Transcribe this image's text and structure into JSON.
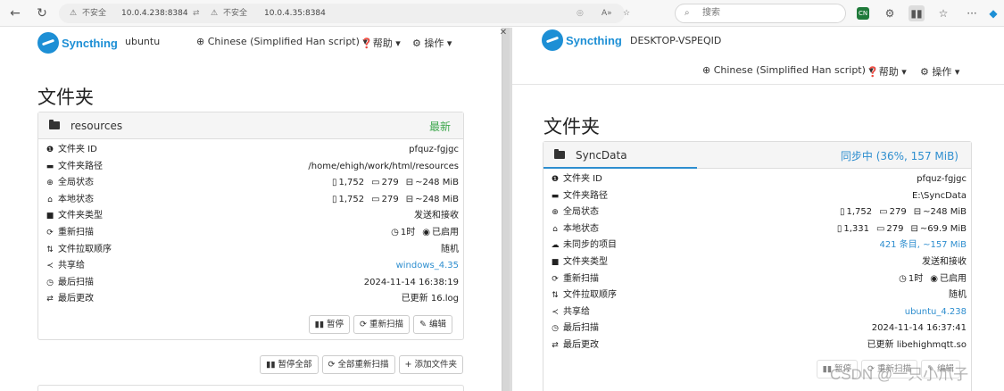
{
  "browser": {
    "url1_warn": "不安全",
    "url1": "10.0.4.238:8384",
    "url2_warn": "不安全",
    "url2": "10.0.4.35:8384",
    "search_placeholder": "搜索",
    "ext_badge": "CN"
  },
  "left": {
    "logo": "Syncthing",
    "device": "ubuntu",
    "language": "Chinese (Simplified Han script)",
    "help": "帮助",
    "actions": "操作",
    "heading": "文件夹",
    "folder": {
      "name": "resources",
      "status": "最新",
      "rows": [
        {
          "icon": "info-icon",
          "label": "文件夹 ID",
          "value": "pfquz-fgjgc"
        },
        {
          "icon": "folder-open-icon",
          "label": "文件夹路径",
          "value": "/home/ehigh/work/html/resources"
        },
        {
          "icon": "globe-icon",
          "label": "全局状态",
          "files": "1,752",
          "dirs": "279",
          "size": "~248 MiB"
        },
        {
          "icon": "home-icon",
          "label": "本地状态",
          "files": "1,752",
          "dirs": "279",
          "size": "~248 MiB"
        },
        {
          "icon": "folder-icon",
          "label": "文件夹类型",
          "value": "发送和接收"
        },
        {
          "icon": "refresh-icon",
          "label": "重新扫描",
          "interval": "1时",
          "watch": "已启用"
        },
        {
          "icon": "sort-icon",
          "label": "文件拉取顺序",
          "value": "随机"
        },
        {
          "icon": "share-icon",
          "label": "共享给",
          "value": "windows_4.35"
        },
        {
          "icon": "clock-icon",
          "label": "最后扫描",
          "value": "2024-11-14 16:38:19"
        },
        {
          "icon": "exchange-icon",
          "label": "最后更改",
          "value": "已更新 16.log"
        }
      ],
      "buttons": {
        "pause": "暂停",
        "rescan": "重新扫描",
        "edit": "编辑"
      }
    },
    "global_buttons": {
      "pause_all": "暂停全部",
      "rescan_all": "全部重新扫描",
      "add_folder": "添加文件夹"
    }
  },
  "right": {
    "logo": "Syncthing",
    "device": "DESKTOP-VSPEQID",
    "language": "Chinese (Simplified Han script)",
    "help": "帮助",
    "actions": "操作",
    "heading": "文件夹",
    "folder": {
      "name": "SyncData",
      "status": "同步中 (36%, 157 MiB)",
      "progress": 0.36,
      "rows": [
        {
          "icon": "info-icon",
          "label": "文件夹 ID",
          "value": "pfquz-fgjgc"
        },
        {
          "icon": "folder-open-icon",
          "label": "文件夹路径",
          "value": "E:\\SyncData"
        },
        {
          "icon": "globe-icon",
          "label": "全局状态",
          "files": "1,752",
          "dirs": "279",
          "size": "~248 MiB"
        },
        {
          "icon": "home-icon",
          "label": "本地状态",
          "files": "1,331",
          "dirs": "279",
          "size": "~69.9 MiB"
        },
        {
          "icon": "cloud-download-icon",
          "label": "未同步的项目",
          "value": "421 条目, ~157 MiB"
        },
        {
          "icon": "folder-icon",
          "label": "文件夹类型",
          "value": "发送和接收"
        },
        {
          "icon": "refresh-icon",
          "label": "重新扫描",
          "interval": "1时",
          "watch": "已启用"
        },
        {
          "icon": "sort-icon",
          "label": "文件拉取顺序",
          "value": "随机"
        },
        {
          "icon": "share-icon",
          "label": "共享给",
          "value": "ubuntu_4.238"
        },
        {
          "icon": "clock-icon",
          "label": "最后扫描",
          "value": "2024-11-14 16:37:41"
        },
        {
          "icon": "exchange-icon",
          "label": "最后更改",
          "value": "已更新 libehighmqtt.so"
        }
      ],
      "buttons": {
        "pause": "暂停",
        "rescan": "重新扫描",
        "edit": "编辑"
      }
    }
  },
  "watermark": "CSDN @一只小爪子",
  "colors": {
    "accent": "#2e8ecf",
    "uptodate": "#3fa84e",
    "logo": "#1d8fd5"
  }
}
